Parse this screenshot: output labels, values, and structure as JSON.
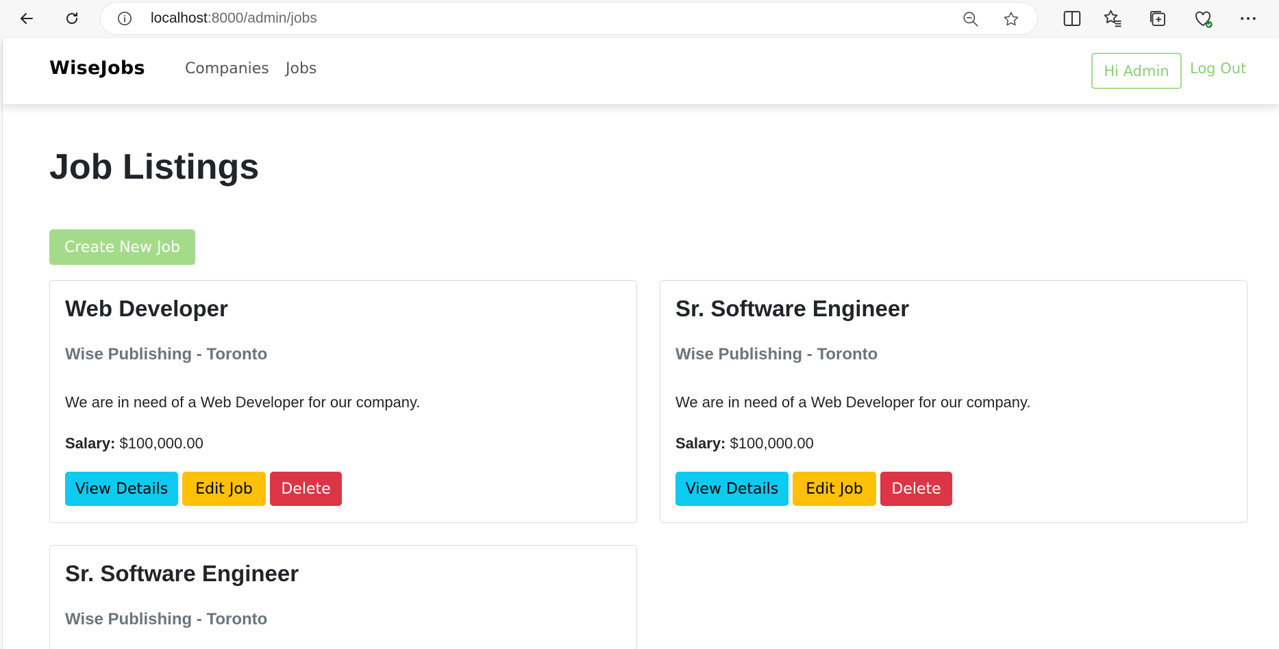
{
  "browser": {
    "url_host": "localhost",
    "url_path": ":8000/admin/jobs"
  },
  "site": {
    "brand": "WiseJobs",
    "nav": [
      "Companies",
      "Jobs"
    ],
    "user_button": "Hi Admin",
    "logout": "Log Out",
    "accent_color": "#8bcf73"
  },
  "main": {
    "title": "Job Listings",
    "create_button": "Create New Job",
    "jobs": [
      {
        "title": "Web Developer",
        "company": "Wise Publishing - Toronto",
        "description": "We are in need of a Web Developer for our company.",
        "salary_label": "Salary:",
        "salary": "$100,000.00",
        "actions": [
          "View Details",
          "Edit Job",
          "Delete"
        ]
      },
      {
        "title": "Sr. Software Engineer",
        "company": "Wise Publishing - Toronto",
        "description": "We are in need of a Web Developer for our company.",
        "salary_label": "Salary:",
        "salary": "$100,000.00",
        "actions": [
          "View Details",
          "Edit Job",
          "Delete"
        ]
      },
      {
        "title": "Sr. Software Engineer",
        "company": "Wise Publishing - Toronto"
      }
    ]
  }
}
